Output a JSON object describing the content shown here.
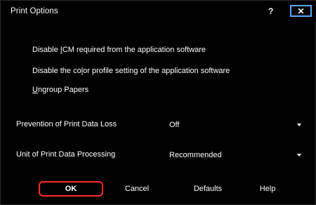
{
  "window": {
    "title": "Print Options",
    "help_glyph": "?",
    "close_glyph": "✕"
  },
  "checkboxes": [
    {
      "label_pre": "Disable ",
      "label_accel": "I",
      "label_post": "CM required from the application software"
    },
    {
      "label_pre": "Disable the co",
      "label_accel": "l",
      "label_post": "or profile setting of the application software"
    },
    {
      "label_pre": "",
      "label_accel": "U",
      "label_post": "ngroup Papers"
    }
  ],
  "settings": {
    "prevention": {
      "label": "Prevention of Print Data Loss",
      "value": "Off"
    },
    "unit": {
      "label": "Unit of Print Data Processing",
      "value": "Recommended"
    }
  },
  "buttons": {
    "ok": "OK",
    "cancel": "Cancel",
    "defaults": "Defaults",
    "help": "Help"
  },
  "colors": {
    "background": "#000000",
    "ok_border": "#ff2a2a",
    "close_border": "#5aa8ff"
  }
}
